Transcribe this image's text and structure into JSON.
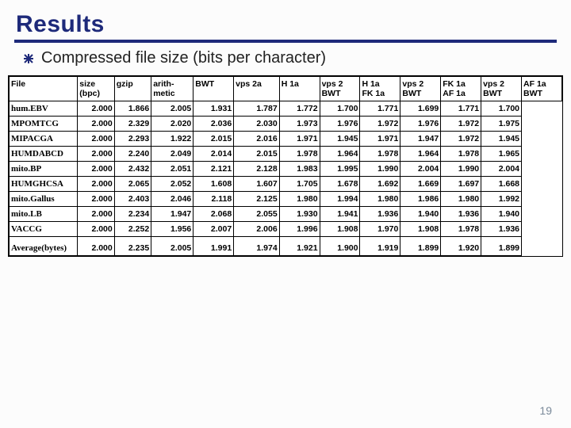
{
  "title": "Results",
  "caption": "Compressed file size (bits per character)",
  "page_number": "19",
  "table": {
    "headers": [
      "File",
      "size\n(bpc)",
      "gzip",
      "arith-\nmetic",
      "BWT",
      "vps 2a",
      "H 1a",
      "vps 2\nBWT",
      "H 1a\nFK 1a",
      "vps 2\nBWT",
      "FK 1a\nAF 1a",
      "vps 2\nBWT",
      "AF 1a\nBWT"
    ],
    "rows": [
      {
        "label": "hum.EBV",
        "values": [
          "2.000",
          "1.866",
          "2.005",
          "1.931",
          "1.787",
          "1.772",
          "1.700",
          "1.771",
          "1.699",
          "1.771",
          "1.700"
        ]
      },
      {
        "label": "MPOMTCG",
        "values": [
          "2.000",
          "2.329",
          "2.020",
          "2.036",
          "2.030",
          "1.973",
          "1.976",
          "1.972",
          "1.976",
          "1.972",
          "1.975"
        ]
      },
      {
        "label": "MIPACGA",
        "values": [
          "2.000",
          "2.293",
          "1.922",
          "2.015",
          "2.016",
          "1.971",
          "1.945",
          "1.971",
          "1.947",
          "1.972",
          "1.945"
        ]
      },
      {
        "label": "HUMDABCD",
        "values": [
          "2.000",
          "2.240",
          "2.049",
          "2.014",
          "2.015",
          "1.978",
          "1.964",
          "1.978",
          "1.964",
          "1.978",
          "1.965"
        ]
      },
      {
        "label": "mito.BP",
        "values": [
          "2.000",
          "2.432",
          "2.051",
          "2.121",
          "2.128",
          "1.983",
          "1.995",
          "1.990",
          "2.004",
          "1.990",
          "2.004"
        ]
      },
      {
        "label": "HUMGHCSA",
        "values": [
          "2.000",
          "2.065",
          "2.052",
          "1.608",
          "1.607",
          "1.705",
          "1.678",
          "1.692",
          "1.669",
          "1.697",
          "1.668"
        ]
      },
      {
        "label": "mito.Gallus",
        "values": [
          "2.000",
          "2.403",
          "2.046",
          "2.118",
          "2.125",
          "1.980",
          "1.994",
          "1.980",
          "1.986",
          "1.980",
          "1.992"
        ]
      },
      {
        "label": "mito.LB",
        "values": [
          "2.000",
          "2.234",
          "1.947",
          "2.068",
          "2.055",
          "1.930",
          "1.941",
          "1.936",
          "1.940",
          "1.936",
          "1.940"
        ]
      },
      {
        "label": "VACCG",
        "values": [
          "2.000",
          "2.252",
          "1.956",
          "2.007",
          "2.006",
          "1.996",
          "1.908",
          "1.970",
          "1.908",
          "1.978",
          "1.936"
        ]
      },
      {
        "label": "Average(bytes)",
        "values": [
          "2.000",
          "2.235",
          "2.005",
          "1.991",
          "1.974",
          "1.921",
          "1.900",
          "1.919",
          "1.899",
          "1.920",
          "1.899"
        ]
      }
    ]
  }
}
